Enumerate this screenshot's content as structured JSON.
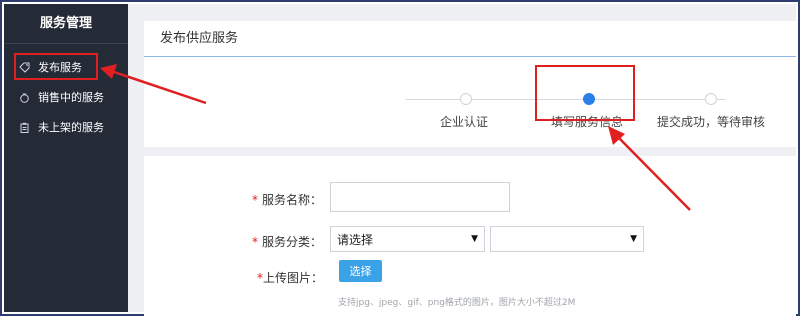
{
  "sidebar": {
    "title": "服务管理",
    "items": [
      {
        "label": "发布服务",
        "icon": "tag-icon"
      },
      {
        "label": "销售中的服务",
        "icon": "money-bag-icon"
      },
      {
        "label": "未上架的服务",
        "icon": "clipboard-icon"
      }
    ]
  },
  "main": {
    "page_title": "发布供应服务",
    "steps": [
      {
        "label": "企业认证",
        "state": "done"
      },
      {
        "label": "填写服务信息",
        "state": "active"
      },
      {
        "label": "提交成功，等待审核",
        "state": "pending"
      }
    ],
    "form": {
      "service_name_label": "服务名称：",
      "service_name_value": "",
      "category_label": "服务分类：",
      "category_select": "请选择",
      "subcategory_select": "",
      "upload_label": "上传图片：",
      "required_mark": "*",
      "choose_button": "选择",
      "upload_hint": "支持jpg、jpeg、gif、png格式的图片，图片大小不超过2M"
    }
  },
  "colors": {
    "sidebar_bg": "#252a37",
    "accent_blue": "#2b7fe8",
    "highlight_red": "#e02020",
    "button_blue": "#3aa3e8"
  }
}
